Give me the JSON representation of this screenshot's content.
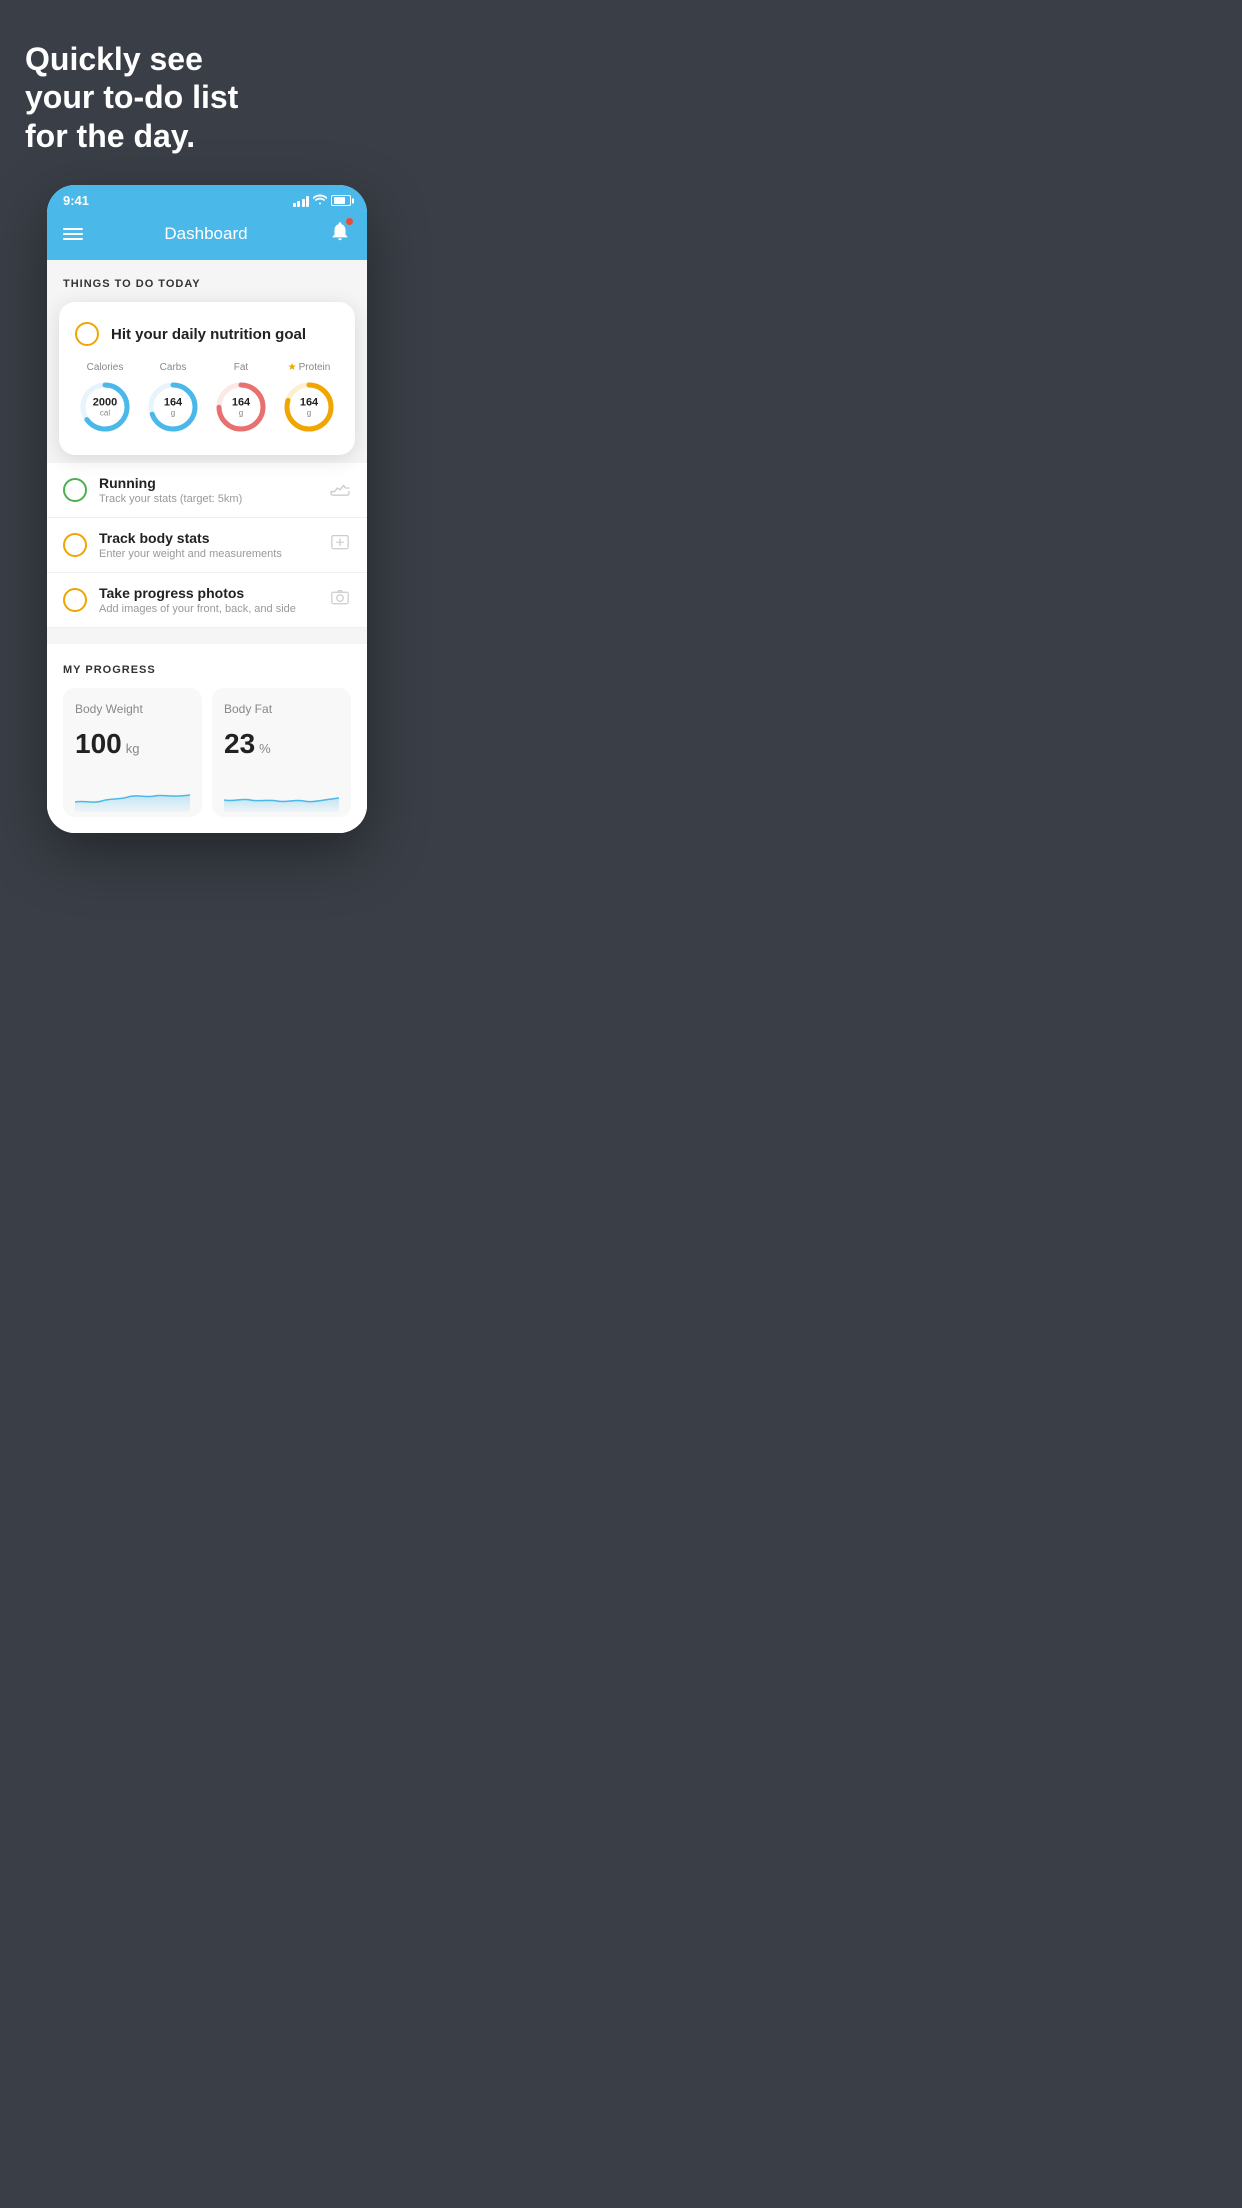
{
  "headline": {
    "line1": "Quickly see",
    "line2": "your to-do list",
    "line3": "for the day."
  },
  "status_bar": {
    "time": "9:41"
  },
  "nav": {
    "title": "Dashboard"
  },
  "things_section": {
    "title": "THINGS TO DO TODAY"
  },
  "nutrition_card": {
    "checkbox_color": "yellow",
    "title": "Hit your daily nutrition goal",
    "items": [
      {
        "label": "Calories",
        "value": "2000",
        "unit": "cal",
        "color": "#4ab8e8",
        "percent": 65
      },
      {
        "label": "Carbs",
        "value": "164",
        "unit": "g",
        "color": "#4ab8e8",
        "percent": 70
      },
      {
        "label": "Fat",
        "value": "164",
        "unit": "g",
        "color": "#e87070",
        "percent": 75
      },
      {
        "label": "Protein",
        "value": "164",
        "unit": "g",
        "color": "#f0a500",
        "percent": 80,
        "starred": true
      }
    ]
  },
  "todo_items": [
    {
      "id": "running",
      "title": "Running",
      "subtitle": "Track your stats (target: 5km)",
      "checkbox_color": "green",
      "icon": "shoe"
    },
    {
      "id": "body-stats",
      "title": "Track body stats",
      "subtitle": "Enter your weight and measurements",
      "checkbox_color": "yellow",
      "icon": "scale"
    },
    {
      "id": "progress-photos",
      "title": "Take progress photos",
      "subtitle": "Add images of your front, back, and side",
      "checkbox_color": "yellow",
      "icon": "photo"
    }
  ],
  "progress_section": {
    "title": "MY PROGRESS",
    "cards": [
      {
        "title": "Body Weight",
        "value": "100",
        "unit": "kg"
      },
      {
        "title": "Body Fat",
        "value": "23",
        "unit": "%"
      }
    ]
  }
}
